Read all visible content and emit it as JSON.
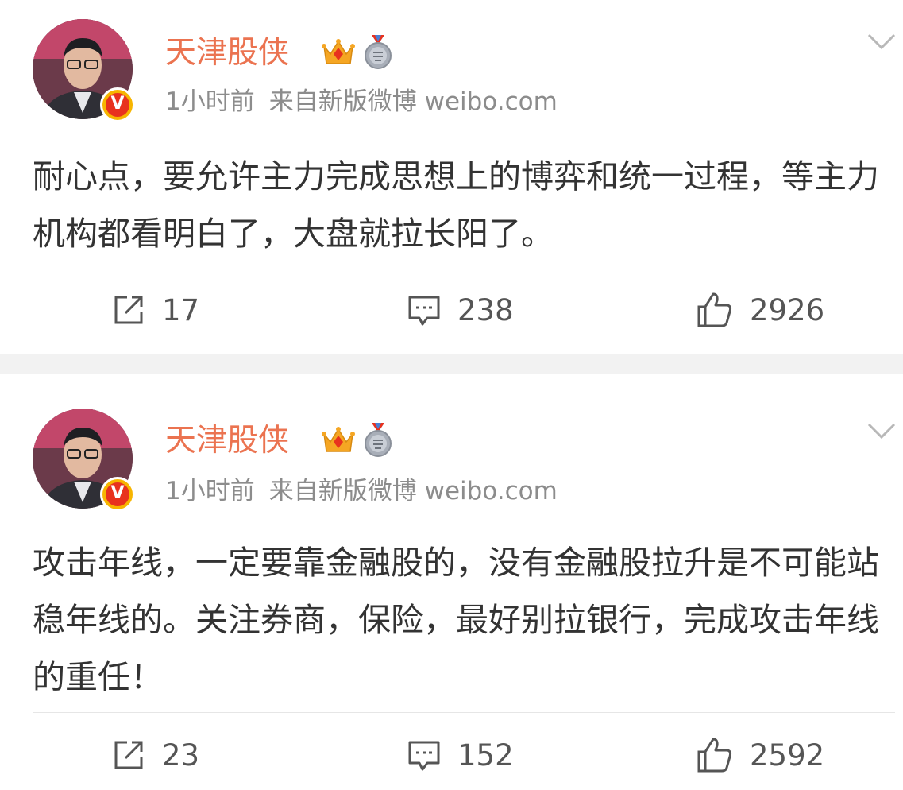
{
  "posts": [
    {
      "username": "天津股侠",
      "time": "1小时前",
      "source": "来自新版微博 weibo.com",
      "content": "耐心点，要允许主力完成思想上的博弈和统一过程，等主力机构都看明白了，大盘就拉长阳了。",
      "reposts": "17",
      "comments": "238",
      "likes": "2926"
    },
    {
      "username": "天津股侠",
      "time": "1小时前",
      "source": "来自新版微博 weibo.com",
      "content": "攻击年线，一定要靠金融股的，没有金融股拉升是不可能站稳年线的。关注券商，保险，最好别拉银行，完成攻击年线的重任！",
      "reposts": "23",
      "comments": "152",
      "likes": "2592"
    }
  ],
  "verified_badge": "V",
  "icons": [
    "crown-icon",
    "medal-icon",
    "chevron-down-icon",
    "repost-icon",
    "comment-icon",
    "like-icon",
    "verified-badge"
  ],
  "colors": {
    "username": "#eb7350",
    "meta": "#8c8c8c",
    "text": "#333333",
    "badge": "#e8321e"
  }
}
